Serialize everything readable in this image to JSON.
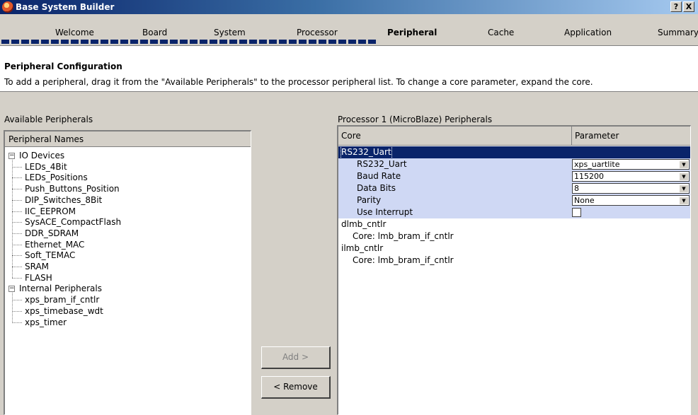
{
  "window": {
    "title": "Base System Builder",
    "help_label": "?",
    "close_label": "X"
  },
  "steps": [
    "Welcome",
    "Board",
    "System",
    "Processor",
    "Peripheral",
    "Cache",
    "Application",
    "Summary"
  ],
  "active_step": "Peripheral",
  "progress": {
    "filled_blocks": 38,
    "total_blocks": 70
  },
  "header": {
    "title": "Peripheral Configuration",
    "description": "To add a peripheral, drag it from the \"Available Peripherals\" to the processor peripheral list. To change a core parameter, expand the core."
  },
  "available": {
    "label": "Available Peripherals",
    "column_header": "Peripheral Names",
    "groups": [
      {
        "label": "IO Devices",
        "expander": "−",
        "items": [
          "LEDs_4Bit",
          "LEDs_Positions",
          "Push_Buttons_Position",
          "DIP_Switches_8Bit",
          "IIC_EEPROM",
          "SysACE_CompactFlash",
          "DDR_SDRAM",
          "Ethernet_MAC",
          "Soft_TEMAC",
          "SRAM",
          "FLASH"
        ]
      },
      {
        "label": "Internal Peripherals",
        "expander": "−",
        "items": [
          "xps_bram_if_cntlr",
          "xps_timebase_wdt",
          "xps_timer"
        ]
      }
    ]
  },
  "buttons": {
    "add": "Add >",
    "remove": "< Remove"
  },
  "processor": {
    "label": "Processor 1 (MicroBlaze) Peripherals",
    "columns": [
      "Core",
      "Parameter"
    ],
    "rows": [
      {
        "core": "RS232_Uart",
        "value": "",
        "kind": "selected"
      },
      {
        "core": "RS232_Uart",
        "value": "xps_uartlite",
        "kind": "combo"
      },
      {
        "core": "Baud Rate",
        "value": "115200",
        "kind": "combo"
      },
      {
        "core": "Data Bits",
        "value": "8",
        "kind": "combo"
      },
      {
        "core": "Parity",
        "value": "None",
        "kind": "combo"
      },
      {
        "core": "Use Interrupt",
        "value": "",
        "kind": "checkbox"
      },
      {
        "core": "dlmb_cntlr",
        "value": "",
        "kind": "plain"
      },
      {
        "core": "Core: lmb_bram_if_cntlr",
        "value": "",
        "kind": "plain-indent"
      },
      {
        "core": "ilmb_cntlr",
        "value": "",
        "kind": "plain"
      },
      {
        "core": "Core: lmb_bram_if_cntlr",
        "value": "",
        "kind": "plain-indent"
      }
    ]
  },
  "colors": {
    "selection": "#0a246a",
    "subrow": "#cfd8f4",
    "face": "#d4d0c8"
  }
}
